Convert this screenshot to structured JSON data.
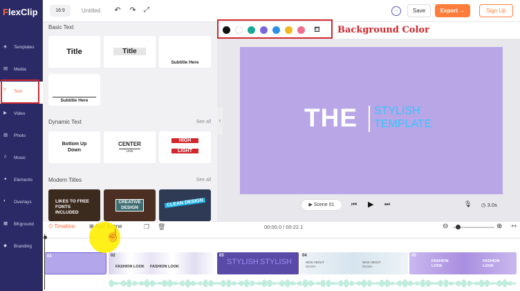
{
  "app": {
    "logo": "FlexClip"
  },
  "sidebar": {
    "items": [
      {
        "label": "Templates",
        "icon": "layers-icon"
      },
      {
        "label": "Media",
        "icon": "folder-icon"
      },
      {
        "label": "Text",
        "icon": "text-icon"
      },
      {
        "label": "Video",
        "icon": "video-icon"
      },
      {
        "label": "Photo",
        "icon": "photo-icon"
      },
      {
        "label": "Music",
        "icon": "music-icon"
      },
      {
        "label": "Elements",
        "icon": "elements-icon"
      },
      {
        "label": "Overlays",
        "icon": "overlays-icon"
      },
      {
        "label": "BKground",
        "icon": "background-icon"
      },
      {
        "label": "Branding",
        "icon": "branding-icon"
      }
    ],
    "active": "Text"
  },
  "topbar": {
    "ratio": "16:9",
    "title": "Untitled",
    "save": "Save",
    "export": "Export →",
    "signup": "Sign Up"
  },
  "panel": {
    "basic_title": "Basic Text",
    "basic_cards": [
      "Title",
      "Title",
      "Subtitle Here",
      "Subtitle Here"
    ],
    "dynamic_title": "Dynamic Text",
    "dynamic_see_all": "See all",
    "dynamic_cards": [
      "Bottom Up Down",
      "CENTER",
      "LINE",
      "HIGH",
      "LIGHT"
    ],
    "modern_title": "Modern Titles",
    "modern_see_all": "See all",
    "modern_cards": [
      "LIKES TO FREE FONTS INCLUDED",
      "CREATIVE DESIGN",
      "CLEAN DESIGN"
    ]
  },
  "background_color": {
    "label": "Background Color",
    "swatches": [
      "#111111",
      "#ffffff",
      "#1aa79a",
      "#7b68d8",
      "#2c8fe6",
      "#f3b520",
      "#ef6e8c"
    ]
  },
  "canvas": {
    "bg": "#b8a6e6",
    "headline": "THE",
    "subtitle_line1": "STYLISH",
    "subtitle_line2": "TEMPLATE"
  },
  "player": {
    "scene": "Scene 01",
    "duration": "3.0s"
  },
  "timeline": {
    "label": "Timeline",
    "add_scene": "Add Scene",
    "timecode": "00:00.0 / 00:22.1",
    "clips": [
      {
        "num": "01"
      },
      {
        "num": "02",
        "text": "FASHION LOOK"
      },
      {
        "num": "03",
        "text": "STYLISH"
      },
      {
        "num": "04",
        "text": "NEW ABOUT OLIVIA"
      },
      {
        "num": "05",
        "text": "FASHION LOOK"
      }
    ]
  }
}
